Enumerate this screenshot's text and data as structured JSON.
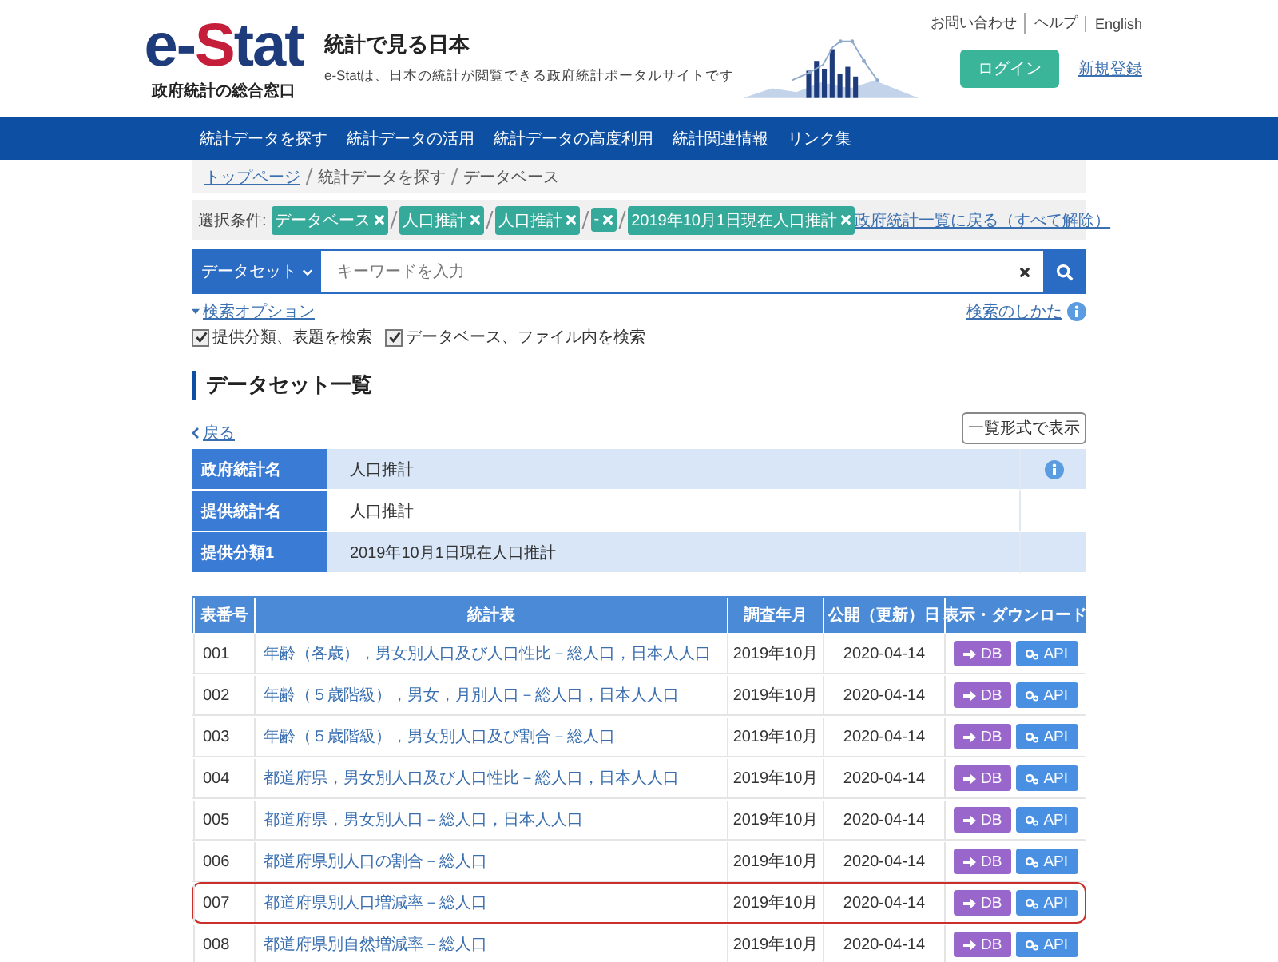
{
  "header": {
    "logo": [
      "e-",
      "S",
      "tat"
    ],
    "logo_caption": "政府統計の総合窓口",
    "site_title": "統計で見る日本",
    "site_description": "e-Statは、日本の統計が閲覧できる政府統計ポータルサイトです",
    "utility_links": [
      "お問い合わせ",
      "ヘルプ",
      "English"
    ],
    "login_button": "ログイン",
    "register_link": "新規登録"
  },
  "nav": [
    "統計データを探す",
    "統計データの活用",
    "統計データの高度利用",
    "統計関連情報",
    "リンク集"
  ],
  "breadcrumb": [
    {
      "label": "トップページ",
      "link": true
    },
    {
      "label": "統計データを探す",
      "link": false
    },
    {
      "label": "データベース",
      "link": false
    }
  ],
  "filters": {
    "label": "選択条件:",
    "chips": [
      "データベース",
      "人口推計",
      "人口推計",
      "-",
      "2019年10月1日現在人口推計"
    ],
    "clear_link": "政府統計一覧に戻る（すべて解除）"
  },
  "search": {
    "scope": "データセット",
    "placeholder": "キーワードを入力"
  },
  "search_options": {
    "toggle": "検索オプション",
    "help_link": "検索のしかた",
    "checkboxes": [
      {
        "label": "提供分類、表題を検索",
        "checked": true
      },
      {
        "label": "データベース、ファイル内を検索",
        "checked": true
      }
    ]
  },
  "section_title": "データセット一覧",
  "back_link": "戻る",
  "list_view_button": "一覧形式で表示",
  "info_rows": [
    {
      "label": "政府統計名",
      "value": "人口推計"
    },
    {
      "label": "提供統計名",
      "value": "人口推計"
    },
    {
      "label": "提供分類1",
      "value": "2019年10月1日現在人口推計"
    }
  ],
  "table": {
    "columns": [
      "表番号",
      "統計表",
      "調査年月",
      "公開（更新）日",
      "表示・ダウンロード"
    ],
    "rows": [
      {
        "number": "001",
        "title": "年齢（各歳），男女別人口及び人口性比－総人口，日本人人口",
        "survey": "2019年10月",
        "published": "2020-04-14",
        "db_button": "DB",
        "api_button": "API",
        "highlighted": false
      },
      {
        "number": "002",
        "title": "年齢（５歳階級），男女，月別人口－総人口，日本人人口",
        "survey": "2019年10月",
        "published": "2020-04-14",
        "db_button": "DB",
        "api_button": "API",
        "highlighted": false
      },
      {
        "number": "003",
        "title": "年齢（５歳階級），男女別人口及び割合－総人口",
        "survey": "2019年10月",
        "published": "2020-04-14",
        "db_button": "DB",
        "api_button": "API",
        "highlighted": false
      },
      {
        "number": "004",
        "title": "都道府県，男女別人口及び人口性比－総人口，日本人人口",
        "survey": "2019年10月",
        "published": "2020-04-14",
        "db_button": "DB",
        "api_button": "API",
        "highlighted": false
      },
      {
        "number": "005",
        "title": "都道府県，男女別人口－総人口，日本人人口",
        "survey": "2019年10月",
        "published": "2020-04-14",
        "db_button": "DB",
        "api_button": "API",
        "highlighted": false
      },
      {
        "number": "006",
        "title": "都道府県別人口の割合－総人口",
        "survey": "2019年10月",
        "published": "2020-04-14",
        "db_button": "DB",
        "api_button": "API",
        "highlighted": false
      },
      {
        "number": "007",
        "title": "都道府県別人口増減率－総人口",
        "survey": "2019年10月",
        "published": "2020-04-14",
        "db_button": "DB",
        "api_button": "API",
        "highlighted": true
      },
      {
        "number": "008",
        "title": "都道府県別自然増減率－総人口",
        "survey": "2019年10月",
        "published": "2020-04-14",
        "db_button": "DB",
        "api_button": "API",
        "highlighted": false
      }
    ]
  }
}
